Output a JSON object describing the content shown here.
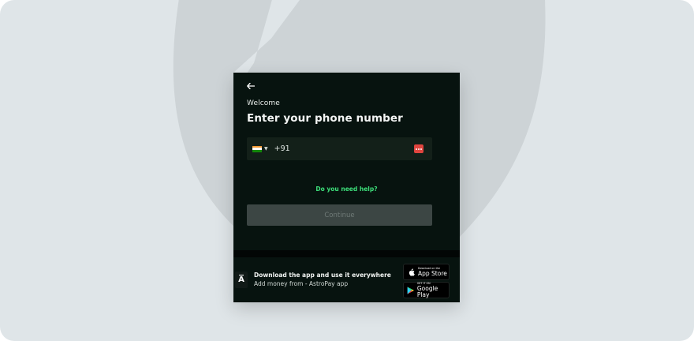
{
  "modal": {
    "welcome": "Welcome",
    "title": "Enter your phone number",
    "phone": {
      "country_code": "+91",
      "value": "",
      "placeholder": ""
    },
    "help_link": "Do you need help?",
    "continue_label": "Continue"
  },
  "app_promo": {
    "logo_letter": "A",
    "title": "Download the app and use it everywhere",
    "subtitle": "Add money from - AstroPay app",
    "app_store": {
      "small": "Download on the",
      "big": "App Store"
    },
    "google_play": {
      "small": "GET IT ON",
      "big": "Google Play"
    }
  },
  "colors": {
    "background": "#dfe5e8",
    "modal": "#07130f",
    "accent_green": "#3ddf7a",
    "button_disabled": "#3c4644",
    "keypad_red": "#e0453f"
  },
  "icons": {
    "back": "arrow-left-icon",
    "flag": "india-flag-icon",
    "dropdown": "caret-down-icon",
    "keypad": "keypad-icon",
    "apple": "apple-icon",
    "google_play": "google-play-icon"
  }
}
